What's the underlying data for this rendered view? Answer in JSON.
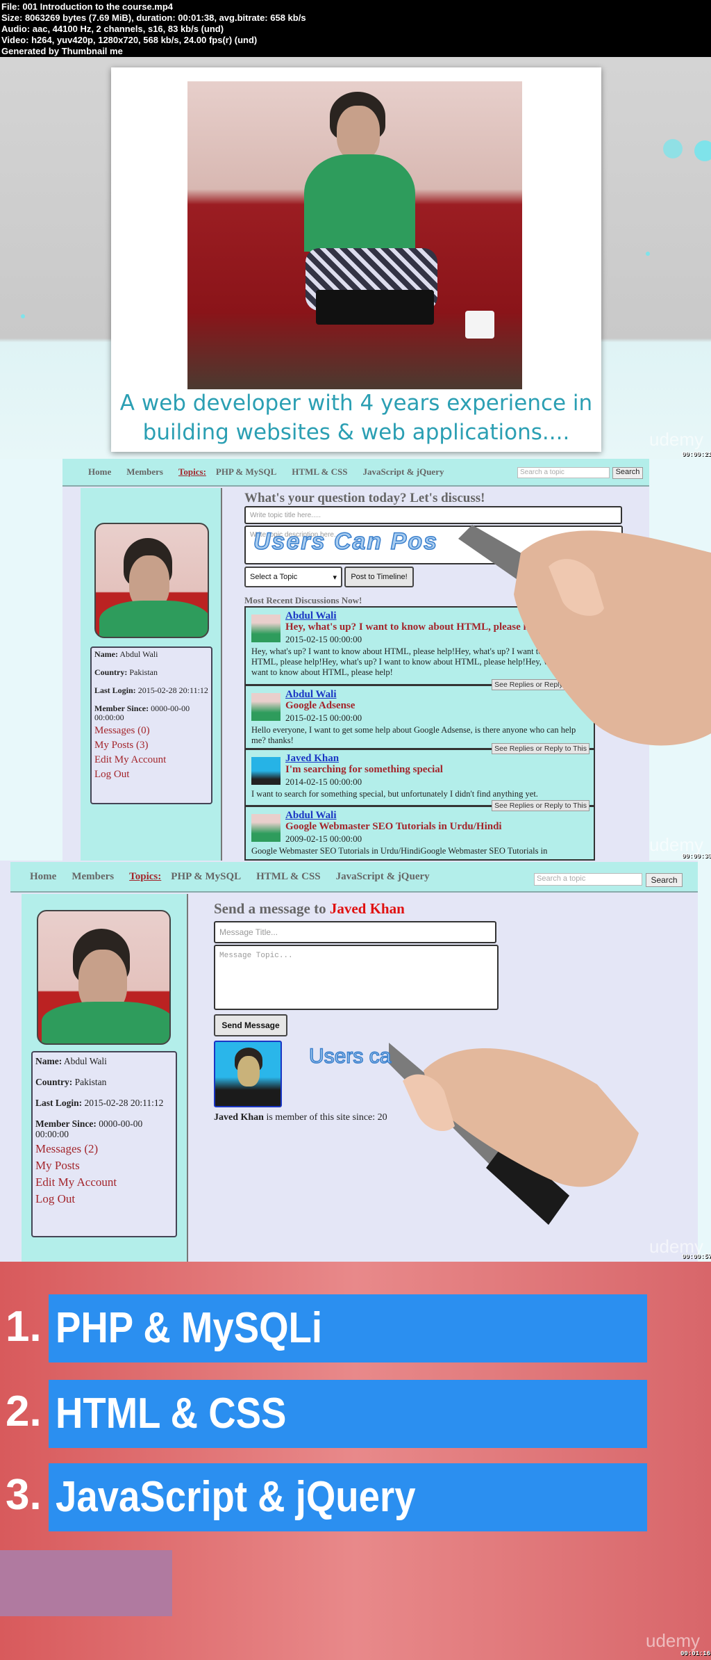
{
  "info": {
    "lines": [
      "File: 001 Introduction to the course.mp4",
      "Size: 8063269 bytes (7.69 MiB), duration: 00:01:38, avg.bitrate: 658 kb/s",
      "Audio: aac, 44100 Hz, 2 channels, s16, 83 kb/s (und)",
      "Video: h264, yuv420p, 1280x720, 568 kb/s, 24.00 fps(r) (und)",
      "Generated by Thumbnail me"
    ]
  },
  "frame1": {
    "caption_line1": "A web developer with 4 years experience in",
    "caption_line2": "building websites & web applications....",
    "watermark": "udemy",
    "timestamp": "00:00:21"
  },
  "nav": {
    "home": "Home",
    "members": "Members",
    "topics": "Topics:",
    "php": "PHP & MySQL",
    "html": "HTML & CSS",
    "js": "JavaScript & jQuery",
    "search_placeholder": "Search a topic",
    "search_button": "Search"
  },
  "profile": {
    "name_label": "Name:",
    "name": "Abdul Wali",
    "country_label": "Country:",
    "country": "Pakistan",
    "last_login_label": "Last Login:",
    "last_login": "2015-02-28 20:11:12",
    "member_since_label": "Member Since:",
    "member_since": "0000-00-00 00:00:00",
    "edit": "Edit My Account",
    "logout": "Log Out"
  },
  "frame2": {
    "messages": "Messages (0)",
    "my_posts": "My Posts (3)",
    "heading": "What's your question today? Let's discuss!",
    "title_placeholder": "Write topic title here.....",
    "desc_placeholder": "Write topic description here.....",
    "handwriting": "Users Can Pos",
    "select": "Select a Topic",
    "post_button": "Post to Timeline!",
    "recent": "Most Recent Discussions Now!",
    "reply_label": "See Replies or Reply to This",
    "watermark": "udemy",
    "timestamp": "00:00:39",
    "posts": [
      {
        "author": "Abdul Wali",
        "title": "Hey, what's up? I want to know about HTML, please help!",
        "date": "2015-02-15 00:00:00",
        "body": "Hey, what's up? I want to know about HTML, please help!Hey, what's up? I want to know about HTML, please help!Hey, what's up? I want to know about HTML, please help!Hey, what's up? I want to know about HTML, please help!"
      },
      {
        "author": "Abdul Wali",
        "title": "Google Adsense",
        "date": "2015-02-15 00:00:00",
        "body": "Hello everyone, I want to get some help about Google Adsense, is there anyone who can help me? thanks!"
      },
      {
        "author": "Javed Khan",
        "title": "I'm searching for something special",
        "date": "2014-02-15 00:00:00",
        "body": "I want to search for something special, but unfortunately I didn't find anything yet."
      },
      {
        "author": "Abdul Wali",
        "title": "Google Webmaster SEO Tutorials in Urdu/Hindi",
        "date": "2009-02-15 00:00:00",
        "body": "Google Webmaster SEO Tutorials in Urdu/HindiGoogle Webmaster SEO Tutorials in"
      }
    ]
  },
  "frame3": {
    "messages": "Messages (2)",
    "my_posts": "My Posts",
    "heading_prefix": "Send a message to",
    "recipient": "Javed Khan",
    "title_placeholder": "Message Title...",
    "topic_placeholder": "Message Topic...",
    "send_button": "Send Message",
    "handwriting": "Users ca",
    "member_name": "Javed Khan",
    "member_text": "is member of this site since: 20",
    "watermark": "udemy",
    "timestamp": "00:00:57"
  },
  "frame4": {
    "items": [
      {
        "num": "1.",
        "label": "PHP & MySQLi"
      },
      {
        "num": "2.",
        "label": "HTML & CSS"
      },
      {
        "num": "3.",
        "label": "JavaScript & jQuery"
      }
    ],
    "accent": "#2b8ff0",
    "watermark": "udemy",
    "timestamp": "00:01:16"
  }
}
